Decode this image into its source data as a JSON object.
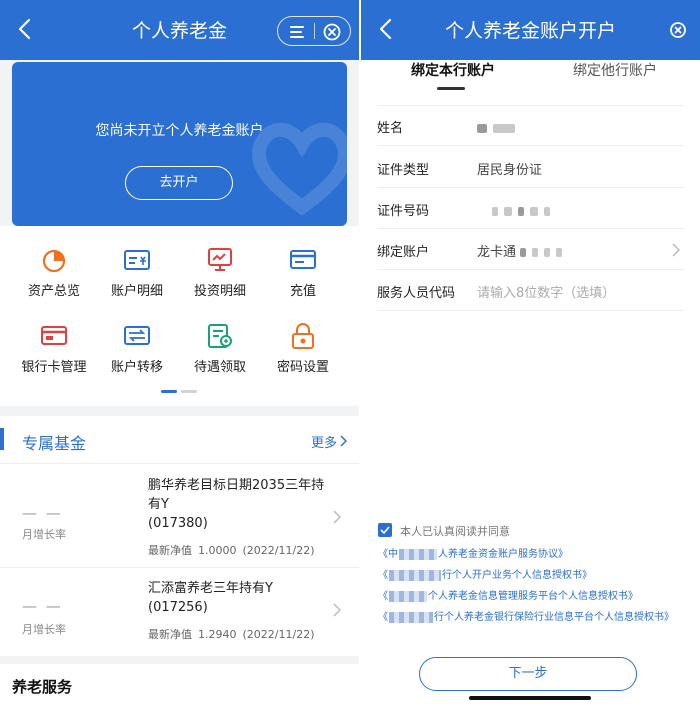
{
  "left": {
    "title": "个人养老金",
    "banner": {
      "message": "您尚未开立个人养老金账户",
      "button": "去开户"
    },
    "menu": [
      {
        "label": "资产总览",
        "icon": "pie-chart-icon"
      },
      {
        "label": "账户明细",
        "icon": "account-detail-icon"
      },
      {
        "label": "投资明细",
        "icon": "investment-monitor-icon"
      },
      {
        "label": "充值",
        "icon": "card-recharge-icon"
      },
      {
        "label": "银行卡管理",
        "icon": "bank-card-icon"
      },
      {
        "label": "账户转移",
        "icon": "account-transfer-icon"
      },
      {
        "label": "待遇领取",
        "icon": "benefit-claim-icon"
      },
      {
        "label": "密码设置",
        "icon": "lock-icon"
      }
    ],
    "section": {
      "title": "专属基金",
      "more": "更多"
    },
    "funds": [
      {
        "rate": "— —",
        "rate_label": "月增长率",
        "name": "鹏华养老目标日期2035三年持有Y",
        "code": "(017380)",
        "nav_label": "最新净值",
        "nav_value": "1.0000",
        "nav_date": "(2022/11/22)"
      },
      {
        "rate": "— —",
        "rate_label": "月增长率",
        "name": "汇添富养老三年持有Y",
        "code": "(017256)",
        "nav_label": "最新净值",
        "nav_value": "1.2940",
        "nav_date": "(2022/11/22)"
      }
    ],
    "service_title": "养老服务"
  },
  "right": {
    "title": "个人养老金账户开户",
    "tabs": [
      "绑定本行账户",
      "绑定他行账户"
    ],
    "fields": {
      "name_label": "姓名",
      "id_type_label": "证件类型",
      "id_type_value": "居民身份证",
      "id_number_label": "证件号码",
      "account_label": "绑定账户",
      "account_value": "龙卡通",
      "staff_code_label": "服务人员代码",
      "staff_code_placeholder": "请输入8位数字（选填）"
    },
    "agreement": "本人已认真阅读并同意",
    "docs": {
      "d1a": "《中",
      "d1b": "人养老金资金账户服务协议》",
      "d2a": "《",
      "d2b": "行个人开户业务个人信息授权书》",
      "d3a": "《",
      "d3b": "个人养老金信息管理服务平台个人信息授权书》",
      "d4a": "《",
      "d4b": "行个人养老金银行保险行业信息平台个人信息授权书》"
    },
    "next_button": "下一步"
  },
  "colors": {
    "primary": "#2b6fd2",
    "page_bg": "#f2f3f5"
  }
}
